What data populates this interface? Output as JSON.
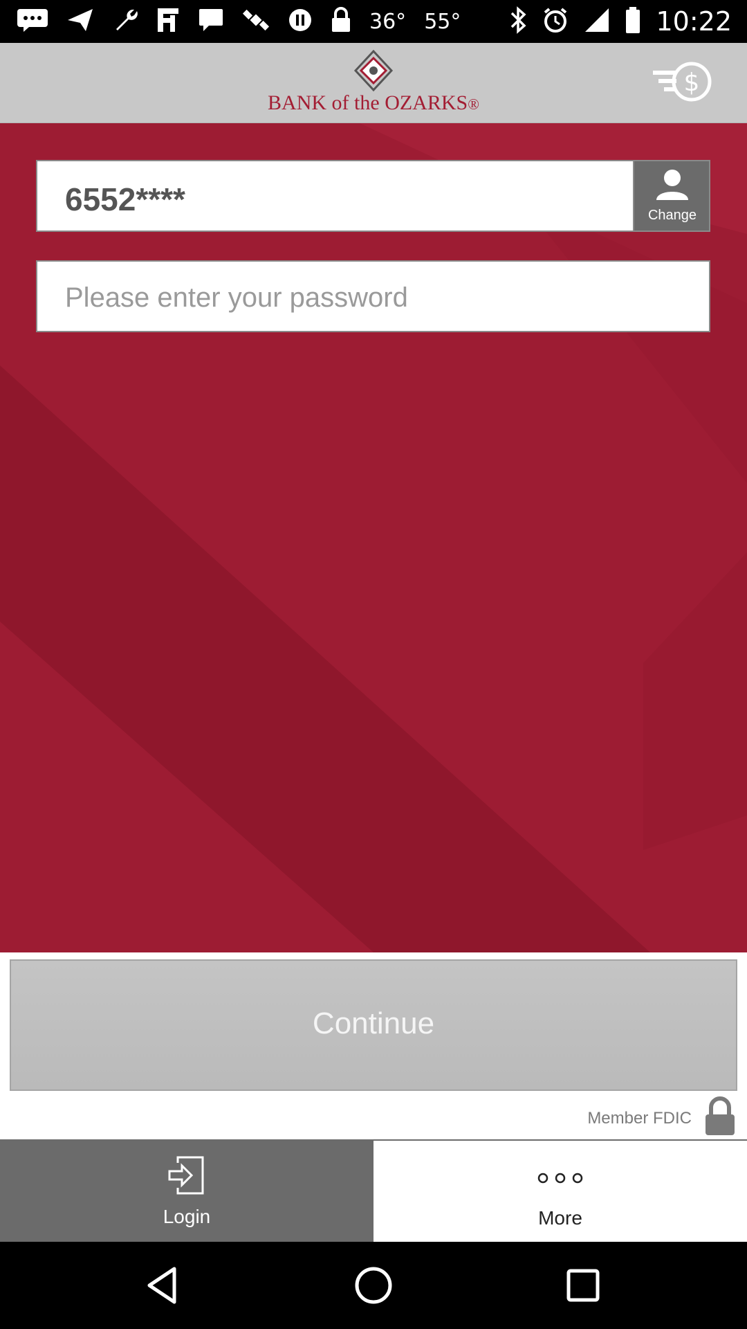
{
  "status_bar": {
    "temp1": "36°",
    "temp2": "55°",
    "time": "10:22"
  },
  "header": {
    "logo_text": "BANK of the OZARKS",
    "logo_registered": "®",
    "brand_color": "#a31d33",
    "menu_icon": "menu-dollar-icon"
  },
  "login_form": {
    "username_value": "6552****",
    "change_label": "Change",
    "password_placeholder": "Please enter your password"
  },
  "actions": {
    "continue_label": "Continue",
    "fdic_text": "Member FDIC"
  },
  "tabs": [
    {
      "label": "Login",
      "icon": "login-icon",
      "active": true
    },
    {
      "label": "More",
      "icon": "more-dots-icon",
      "active": false
    }
  ],
  "colors": {
    "background_red": "#9d1c33",
    "header_gray": "#c8c8c8",
    "tab_active_gray": "#6b6b6b"
  }
}
